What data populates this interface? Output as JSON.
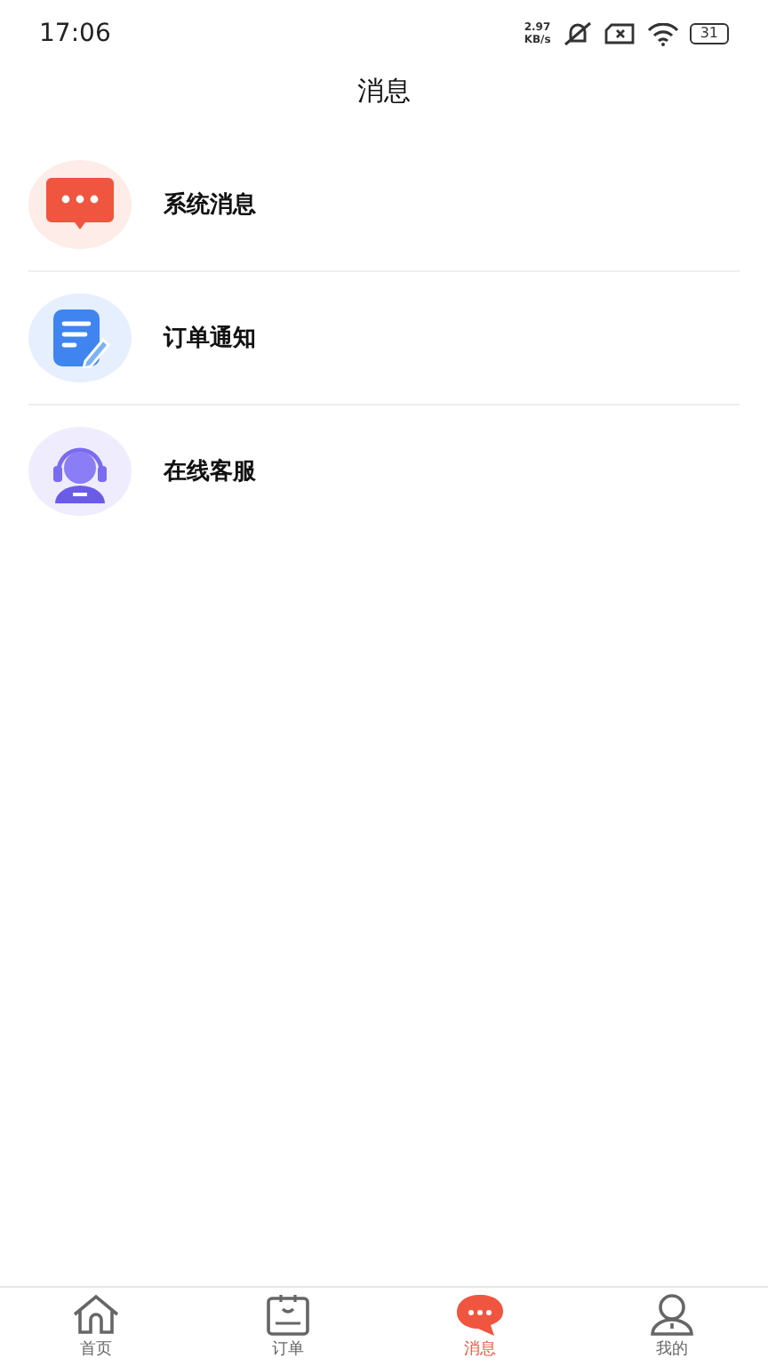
{
  "status_bar": {
    "time": "17:06",
    "speed": [
      "2.97",
      "KB/s"
    ],
    "battery": "31"
  },
  "header": {
    "title": "消息"
  },
  "items": [
    {
      "kind": "system",
      "label": "系统消息"
    },
    {
      "kind": "order",
      "label": "订单通知"
    },
    {
      "kind": "service",
      "label": "在线客服"
    }
  ],
  "tabs": [
    {
      "kind": "home",
      "label": "首页",
      "selected": false
    },
    {
      "kind": "orders",
      "label": "订单",
      "selected": false
    },
    {
      "kind": "messages",
      "label": "消息",
      "selected": true
    },
    {
      "kind": "profile",
      "label": "我的",
      "selected": false
    }
  ]
}
